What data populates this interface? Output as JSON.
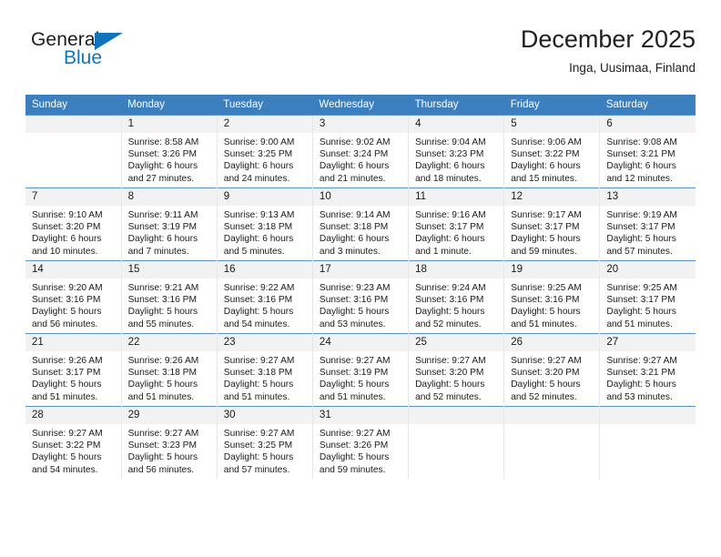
{
  "brand": {
    "name_top": "General",
    "name_bottom": "Blue",
    "accent_color": "#1273bd"
  },
  "header": {
    "title": "December 2025",
    "subtitle": "Inga, Uusimaa, Finland",
    "header_bg": "#3c7fbf",
    "daynum_bg": "#f2f2f2"
  },
  "weekday_headers": [
    "Sunday",
    "Monday",
    "Tuesday",
    "Wednesday",
    "Thursday",
    "Friday",
    "Saturday"
  ],
  "labels": {
    "sunrise": "Sunrise:",
    "sunset": "Sunset:",
    "daylight": "Daylight:"
  },
  "weeks": [
    [
      {
        "day": "",
        "sunrise": "",
        "sunset": "",
        "daylight_1": "",
        "daylight_2": "",
        "blank": true
      },
      {
        "day": "1",
        "sunrise": "Sunrise: 8:58 AM",
        "sunset": "Sunset: 3:26 PM",
        "daylight_1": "Daylight: 6 hours",
        "daylight_2": "and 27 minutes."
      },
      {
        "day": "2",
        "sunrise": "Sunrise: 9:00 AM",
        "sunset": "Sunset: 3:25 PM",
        "daylight_1": "Daylight: 6 hours",
        "daylight_2": "and 24 minutes."
      },
      {
        "day": "3",
        "sunrise": "Sunrise: 9:02 AM",
        "sunset": "Sunset: 3:24 PM",
        "daylight_1": "Daylight: 6 hours",
        "daylight_2": "and 21 minutes."
      },
      {
        "day": "4",
        "sunrise": "Sunrise: 9:04 AM",
        "sunset": "Sunset: 3:23 PM",
        "daylight_1": "Daylight: 6 hours",
        "daylight_2": "and 18 minutes."
      },
      {
        "day": "5",
        "sunrise": "Sunrise: 9:06 AM",
        "sunset": "Sunset: 3:22 PM",
        "daylight_1": "Daylight: 6 hours",
        "daylight_2": "and 15 minutes."
      },
      {
        "day": "6",
        "sunrise": "Sunrise: 9:08 AM",
        "sunset": "Sunset: 3:21 PM",
        "daylight_1": "Daylight: 6 hours",
        "daylight_2": "and 12 minutes."
      }
    ],
    [
      {
        "day": "7",
        "sunrise": "Sunrise: 9:10 AM",
        "sunset": "Sunset: 3:20 PM",
        "daylight_1": "Daylight: 6 hours",
        "daylight_2": "and 10 minutes."
      },
      {
        "day": "8",
        "sunrise": "Sunrise: 9:11 AM",
        "sunset": "Sunset: 3:19 PM",
        "daylight_1": "Daylight: 6 hours",
        "daylight_2": "and 7 minutes."
      },
      {
        "day": "9",
        "sunrise": "Sunrise: 9:13 AM",
        "sunset": "Sunset: 3:18 PM",
        "daylight_1": "Daylight: 6 hours",
        "daylight_2": "and 5 minutes."
      },
      {
        "day": "10",
        "sunrise": "Sunrise: 9:14 AM",
        "sunset": "Sunset: 3:18 PM",
        "daylight_1": "Daylight: 6 hours",
        "daylight_2": "and 3 minutes."
      },
      {
        "day": "11",
        "sunrise": "Sunrise: 9:16 AM",
        "sunset": "Sunset: 3:17 PM",
        "daylight_1": "Daylight: 6 hours",
        "daylight_2": "and 1 minute."
      },
      {
        "day": "12",
        "sunrise": "Sunrise: 9:17 AM",
        "sunset": "Sunset: 3:17 PM",
        "daylight_1": "Daylight: 5 hours",
        "daylight_2": "and 59 minutes."
      },
      {
        "day": "13",
        "sunrise": "Sunrise: 9:19 AM",
        "sunset": "Sunset: 3:17 PM",
        "daylight_1": "Daylight: 5 hours",
        "daylight_2": "and 57 minutes."
      }
    ],
    [
      {
        "day": "14",
        "sunrise": "Sunrise: 9:20 AM",
        "sunset": "Sunset: 3:16 PM",
        "daylight_1": "Daylight: 5 hours",
        "daylight_2": "and 56 minutes."
      },
      {
        "day": "15",
        "sunrise": "Sunrise: 9:21 AM",
        "sunset": "Sunset: 3:16 PM",
        "daylight_1": "Daylight: 5 hours",
        "daylight_2": "and 55 minutes."
      },
      {
        "day": "16",
        "sunrise": "Sunrise: 9:22 AM",
        "sunset": "Sunset: 3:16 PM",
        "daylight_1": "Daylight: 5 hours",
        "daylight_2": "and 54 minutes."
      },
      {
        "day": "17",
        "sunrise": "Sunrise: 9:23 AM",
        "sunset": "Sunset: 3:16 PM",
        "daylight_1": "Daylight: 5 hours",
        "daylight_2": "and 53 minutes."
      },
      {
        "day": "18",
        "sunrise": "Sunrise: 9:24 AM",
        "sunset": "Sunset: 3:16 PM",
        "daylight_1": "Daylight: 5 hours",
        "daylight_2": "and 52 minutes."
      },
      {
        "day": "19",
        "sunrise": "Sunrise: 9:25 AM",
        "sunset": "Sunset: 3:16 PM",
        "daylight_1": "Daylight: 5 hours",
        "daylight_2": "and 51 minutes."
      },
      {
        "day": "20",
        "sunrise": "Sunrise: 9:25 AM",
        "sunset": "Sunset: 3:17 PM",
        "daylight_1": "Daylight: 5 hours",
        "daylight_2": "and 51 minutes."
      }
    ],
    [
      {
        "day": "21",
        "sunrise": "Sunrise: 9:26 AM",
        "sunset": "Sunset: 3:17 PM",
        "daylight_1": "Daylight: 5 hours",
        "daylight_2": "and 51 minutes."
      },
      {
        "day": "22",
        "sunrise": "Sunrise: 9:26 AM",
        "sunset": "Sunset: 3:18 PM",
        "daylight_1": "Daylight: 5 hours",
        "daylight_2": "and 51 minutes."
      },
      {
        "day": "23",
        "sunrise": "Sunrise: 9:27 AM",
        "sunset": "Sunset: 3:18 PM",
        "daylight_1": "Daylight: 5 hours",
        "daylight_2": "and 51 minutes."
      },
      {
        "day": "24",
        "sunrise": "Sunrise: 9:27 AM",
        "sunset": "Sunset: 3:19 PM",
        "daylight_1": "Daylight: 5 hours",
        "daylight_2": "and 51 minutes."
      },
      {
        "day": "25",
        "sunrise": "Sunrise: 9:27 AM",
        "sunset": "Sunset: 3:20 PM",
        "daylight_1": "Daylight: 5 hours",
        "daylight_2": "and 52 minutes."
      },
      {
        "day": "26",
        "sunrise": "Sunrise: 9:27 AM",
        "sunset": "Sunset: 3:20 PM",
        "daylight_1": "Daylight: 5 hours",
        "daylight_2": "and 52 minutes."
      },
      {
        "day": "27",
        "sunrise": "Sunrise: 9:27 AM",
        "sunset": "Sunset: 3:21 PM",
        "daylight_1": "Daylight: 5 hours",
        "daylight_2": "and 53 minutes."
      }
    ],
    [
      {
        "day": "28",
        "sunrise": "Sunrise: 9:27 AM",
        "sunset": "Sunset: 3:22 PM",
        "daylight_1": "Daylight: 5 hours",
        "daylight_2": "and 54 minutes."
      },
      {
        "day": "29",
        "sunrise": "Sunrise: 9:27 AM",
        "sunset": "Sunset: 3:23 PM",
        "daylight_1": "Daylight: 5 hours",
        "daylight_2": "and 56 minutes."
      },
      {
        "day": "30",
        "sunrise": "Sunrise: 9:27 AM",
        "sunset": "Sunset: 3:25 PM",
        "daylight_1": "Daylight: 5 hours",
        "daylight_2": "and 57 minutes."
      },
      {
        "day": "31",
        "sunrise": "Sunrise: 9:27 AM",
        "sunset": "Sunset: 3:26 PM",
        "daylight_1": "Daylight: 5 hours",
        "daylight_2": "and 59 minutes."
      },
      {
        "day": "",
        "sunrise": "",
        "sunset": "",
        "daylight_1": "",
        "daylight_2": "",
        "blank": true
      },
      {
        "day": "",
        "sunrise": "",
        "sunset": "",
        "daylight_1": "",
        "daylight_2": "",
        "blank": true
      },
      {
        "day": "",
        "sunrise": "",
        "sunset": "",
        "daylight_1": "",
        "daylight_2": "",
        "blank": true
      }
    ]
  ]
}
